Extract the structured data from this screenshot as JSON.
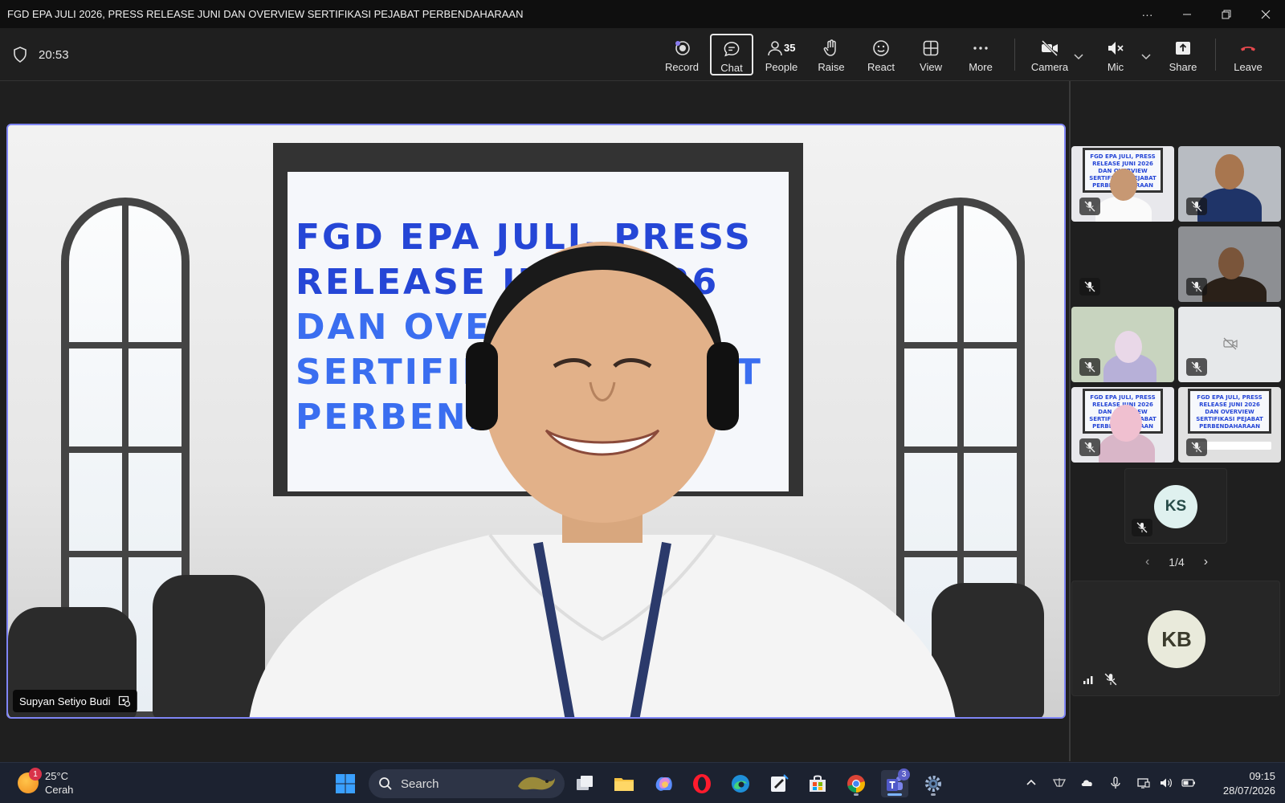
{
  "window": {
    "title": "FGD EPA JULI 2026, PRESS RELEASE JUNI DAN OVERVIEW SERTIFIKASI PEJABAT PERBENDAHARAAN"
  },
  "toolbar": {
    "timer": "20:53",
    "record_label": "Record",
    "chat_label": "Chat",
    "people_label": "People",
    "people_count": "35",
    "raise_label": "Raise",
    "react_label": "React",
    "view_label": "View",
    "more_label": "More",
    "camera_label": "Camera",
    "mic_label": "Mic",
    "share_label": "Share",
    "leave_label": "Leave"
  },
  "stage": {
    "speaker_name": "Supyan Setiyo Budi",
    "screen_lines": [
      "FGD  EPA  JULI,  PRESS",
      "RELEASE  JUNI  2026",
      "DAN       OVERVIEW",
      "SERTIFIKASI  PEJABAT",
      "PERBENDAHARAAN"
    ]
  },
  "gallery": {
    "poster_lines": [
      "FGD EPA JULI, PRESS",
      "RELEASE JUNI 2026",
      "DAN OVERVIEW",
      "SERTIFIKASI PEJABAT",
      "PERBENDAHARAAN"
    ],
    "avatar_ks": "KS",
    "avatar_kb": "KB",
    "pager": "1/4"
  },
  "taskbar": {
    "weather_temp": "25°C",
    "weather_desc": "Cerah",
    "weather_badge": "1",
    "search_label": "Search",
    "teams_badge": "3",
    "time": "09:15",
    "date": "28/07/2026"
  },
  "colors": {
    "accent": "#7f85f5",
    "leave": "#e5484d",
    "poster_blue": "#2546d6"
  }
}
